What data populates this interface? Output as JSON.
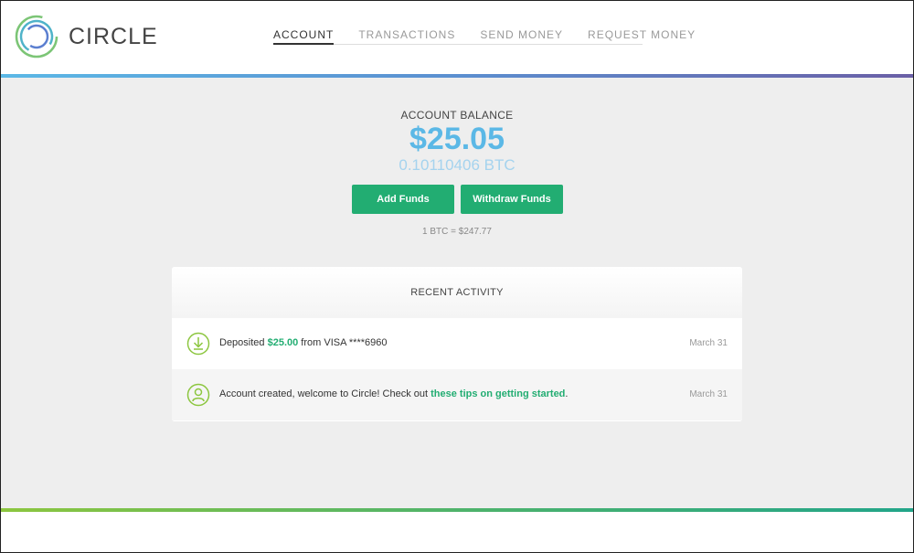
{
  "brand": {
    "name": "CIRCLE",
    "logo_icon": "circle-logo-icon",
    "colors": {
      "teal": "#22ad72",
      "blue": "#5bb8e6"
    }
  },
  "nav": [
    {
      "label": "ACCOUNT",
      "active": true
    },
    {
      "label": "TRANSACTIONS",
      "active": false
    },
    {
      "label": "SEND MONEY",
      "active": false
    },
    {
      "label": "REQUEST MONEY",
      "active": false
    }
  ],
  "balance": {
    "label": "ACCOUNT BALANCE",
    "usd": "$25.05",
    "btc": "0.10110406 BTC",
    "rate": "1 BTC = $247.77"
  },
  "actions": {
    "add_funds": "Add Funds",
    "withdraw_funds": "Withdraw Funds"
  },
  "activity": {
    "title": "RECENT ACTIVITY",
    "items": [
      {
        "icon": "download-icon",
        "prefix": "Deposited ",
        "highlight": "$25.00",
        "suffix": " from VISA ****6960",
        "date": "March 31"
      },
      {
        "icon": "user-icon",
        "prefix": "Account created, welcome to Circle! Check out ",
        "highlight": "these tips on getting started",
        "suffix": ".",
        "date": "March 31"
      }
    ]
  }
}
